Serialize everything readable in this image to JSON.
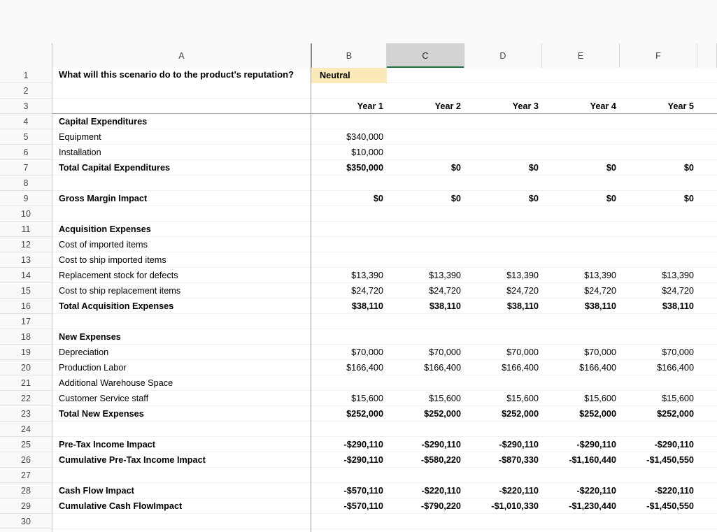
{
  "app": {
    "type": "spreadsheet",
    "select_all_corner_icon": "select-all-triangle-icon"
  },
  "columns": {
    "headers": [
      "A",
      "B",
      "C",
      "D",
      "E",
      "F"
    ],
    "selected": "C",
    "selection_underline_color": "#1e6f42",
    "selected_header_bg": "#d3d3d3"
  },
  "rows": {
    "numbers": [
      1,
      2,
      3,
      4,
      5,
      6,
      7,
      8,
      9,
      10,
      11,
      12,
      13,
      14,
      15,
      16,
      17,
      18,
      19,
      20,
      21,
      22,
      23,
      24,
      25,
      26,
      27,
      28,
      29,
      30
    ]
  },
  "question": {
    "text": "What will this scenario do to the product's reputation?",
    "answer": "Neutral",
    "answer_bg": "#fce9b9"
  },
  "year_headers": {
    "b": "Year 1",
    "c": "Year 2",
    "d": "Year 3",
    "e": "Year 4",
    "f": "Year 5"
  },
  "sheet_rows": [
    {
      "n": 1,
      "a": "",
      "b": "",
      "c": "",
      "d": "",
      "e": "",
      "f": "",
      "bold": false,
      "special": "question"
    },
    {
      "n": 2,
      "a": "",
      "b": "",
      "c": "",
      "d": "",
      "e": "",
      "f": "",
      "bold": false
    },
    {
      "n": 3,
      "a": "",
      "b": "Year 1",
      "c": "Year 2",
      "d": "Year 3",
      "e": "Year 4",
      "f": "Year 5",
      "bold": true,
      "special": "years"
    },
    {
      "n": 4,
      "a": "Capital Expenditures",
      "b": "",
      "c": "",
      "d": "",
      "e": "",
      "f": "",
      "bold": true
    },
    {
      "n": 5,
      "a": "Equipment",
      "b": "$340,000",
      "c": "",
      "d": "",
      "e": "",
      "f": "",
      "bold": false
    },
    {
      "n": 6,
      "a": "Installation",
      "b": "$10,000",
      "c": "",
      "d": "",
      "e": "",
      "f": "",
      "bold": false
    },
    {
      "n": 7,
      "a": "Total Capital Expenditures",
      "b": "$350,000",
      "c": "$0",
      "d": "$0",
      "e": "$0",
      "f": "$0",
      "bold": true
    },
    {
      "n": 8,
      "a": "",
      "b": "",
      "c": "",
      "d": "",
      "e": "",
      "f": "",
      "bold": false
    },
    {
      "n": 9,
      "a": "Gross Margin Impact",
      "b": "$0",
      "c": "$0",
      "d": "$0",
      "e": "$0",
      "f": "$0",
      "bold": true
    },
    {
      "n": 10,
      "a": "",
      "b": "",
      "c": "",
      "d": "",
      "e": "",
      "f": "",
      "bold": false
    },
    {
      "n": 11,
      "a": "Acquisition Expenses",
      "b": "",
      "c": "",
      "d": "",
      "e": "",
      "f": "",
      "bold": true
    },
    {
      "n": 12,
      "a": "Cost of imported items",
      "b": "",
      "c": "",
      "d": "",
      "e": "",
      "f": "",
      "bold": false
    },
    {
      "n": 13,
      "a": "Cost to ship imported items",
      "b": "",
      "c": "",
      "d": "",
      "e": "",
      "f": "",
      "bold": false
    },
    {
      "n": 14,
      "a": "Replacement stock for defects",
      "b": "$13,390",
      "c": "$13,390",
      "d": "$13,390",
      "e": "$13,390",
      "f": "$13,390",
      "bold": false
    },
    {
      "n": 15,
      "a": "Cost to ship replacement items",
      "b": "$24,720",
      "c": "$24,720",
      "d": "$24,720",
      "e": "$24,720",
      "f": "$24,720",
      "bold": false
    },
    {
      "n": 16,
      "a": "Total Acquisition Expenses",
      "b": "$38,110",
      "c": "$38,110",
      "d": "$38,110",
      "e": "$38,110",
      "f": "$38,110",
      "bold": true
    },
    {
      "n": 17,
      "a": "",
      "b": "",
      "c": "",
      "d": "",
      "e": "",
      "f": "",
      "bold": false
    },
    {
      "n": 18,
      "a": "New Expenses",
      "b": "",
      "c": "",
      "d": "",
      "e": "",
      "f": "",
      "bold": true
    },
    {
      "n": 19,
      "a": "Depreciation",
      "b": "$70,000",
      "c": "$70,000",
      "d": "$70,000",
      "e": "$70,000",
      "f": "$70,000",
      "bold": false
    },
    {
      "n": 20,
      "a": "Production Labor",
      "b": "$166,400",
      "c": "$166,400",
      "d": "$166,400",
      "e": "$166,400",
      "f": "$166,400",
      "bold": false
    },
    {
      "n": 21,
      "a": "Additional Warehouse Space",
      "b": "",
      "c": "",
      "d": "",
      "e": "",
      "f": "",
      "bold": false
    },
    {
      "n": 22,
      "a": "Customer Service staff",
      "b": "$15,600",
      "c": "$15,600",
      "d": "$15,600",
      "e": "$15,600",
      "f": "$15,600",
      "bold": false
    },
    {
      "n": 23,
      "a": "Total New Expenses",
      "b": "$252,000",
      "c": "$252,000",
      "d": "$252,000",
      "e": "$252,000",
      "f": "$252,000",
      "bold": true
    },
    {
      "n": 24,
      "a": "",
      "b": "",
      "c": "",
      "d": "",
      "e": "",
      "f": "",
      "bold": false
    },
    {
      "n": 25,
      "a": "Pre-Tax Income Impact",
      "b": "-$290,110",
      "c": "-$290,110",
      "d": "-$290,110",
      "e": "-$290,110",
      "f": "-$290,110",
      "bold": true
    },
    {
      "n": 26,
      "a": "Cumulative Pre-Tax Income Impact",
      "b": "-$290,110",
      "c": "-$580,220",
      "d": "-$870,330",
      "e": "-$1,160,440",
      "f": "-$1,450,550",
      "bold": true
    },
    {
      "n": 27,
      "a": "",
      "b": "",
      "c": "",
      "d": "",
      "e": "",
      "f": "",
      "bold": false
    },
    {
      "n": 28,
      "a": "Cash Flow Impact",
      "b": "-$570,110",
      "c": "-$220,110",
      "d": "-$220,110",
      "e": "-$220,110",
      "f": "-$220,110",
      "bold": true
    },
    {
      "n": 29,
      "a": "Cumulative Cash FlowImpact",
      "b": "-$570,110",
      "c": "-$790,220",
      "d": "-$1,010,330",
      "e": "-$1,230,440",
      "f": "-$1,450,550",
      "bold": true
    },
    {
      "n": 30,
      "a": "",
      "b": "",
      "c": "",
      "d": "",
      "e": "",
      "f": "",
      "bold": false
    }
  ]
}
